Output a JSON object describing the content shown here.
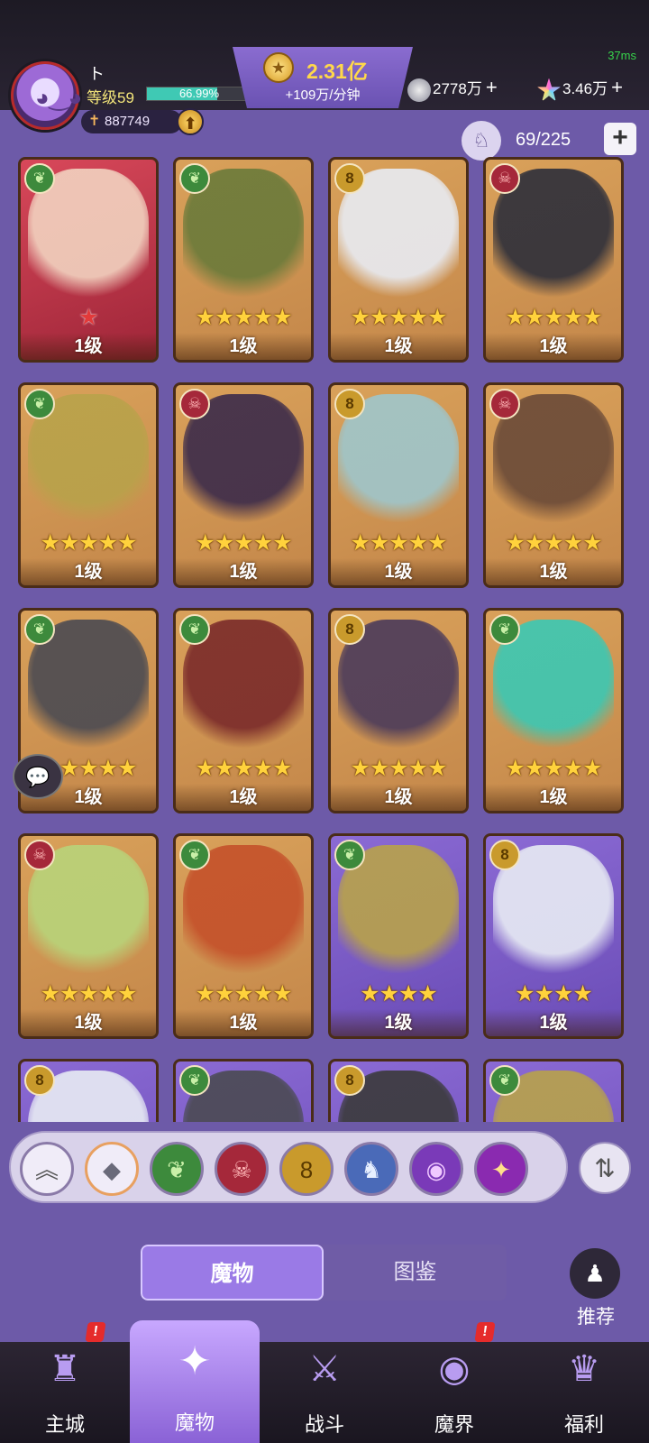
{
  "status": {
    "ping": "37ms"
  },
  "player": {
    "name": "ト",
    "level": "等级59",
    "exp_percent": "66.99%",
    "exp_fraction": 0.6699,
    "power": "887749"
  },
  "currency": {
    "gold": "2.31亿",
    "gold_rate": "+109万/分钟",
    "resource1": "2778万",
    "resource2": "3.46万"
  },
  "roster": {
    "capacity": "69/225"
  },
  "cards": [
    {
      "faction": "nature",
      "glyph": "❦",
      "stars": "★",
      "stars_count": 1,
      "level": "1级",
      "bg": "red",
      "art": "#f2d3c0"
    },
    {
      "faction": "nature",
      "glyph": "❦",
      "stars": "★★★★★",
      "stars_count": 5,
      "level": "1级",
      "bg": "gold",
      "art": "#6a7a3a"
    },
    {
      "faction": "order",
      "glyph": "8",
      "stars": "★★★★★",
      "stars_count": 5,
      "level": "1级",
      "bg": "gold",
      "art": "#e8ecf4"
    },
    {
      "faction": "demon",
      "glyph": "☠",
      "stars": "★★★★★",
      "stars_count": 5,
      "level": "1级",
      "bg": "gold",
      "art": "#2c2e3a"
    },
    {
      "faction": "nature",
      "glyph": "❦",
      "stars": "★★★★★",
      "stars_count": 5,
      "level": "1级",
      "bg": "gold",
      "art": "#b8a24a"
    },
    {
      "faction": "demon",
      "glyph": "☠",
      "stars": "★★★★★",
      "stars_count": 5,
      "level": "1级",
      "bg": "gold",
      "art": "#3a2a4a"
    },
    {
      "faction": "order",
      "glyph": "8",
      "stars": "★★★★★",
      "stars_count": 5,
      "level": "1级",
      "bg": "gold",
      "art": "#9ec6cc"
    },
    {
      "faction": "demon",
      "glyph": "☠",
      "stars": "★★★★★",
      "stars_count": 5,
      "level": "1级",
      "bg": "gold",
      "art": "#6a4a38"
    },
    {
      "faction": "nature",
      "glyph": "❦",
      "stars": "★★★★★",
      "stars_count": 5,
      "level": "1级",
      "bg": "gold",
      "art": "#4a4a52"
    },
    {
      "faction": "nature",
      "glyph": "❦",
      "stars": "★★★★★",
      "stars_count": 5,
      "level": "1级",
      "bg": "gold",
      "art": "#7a2a2a"
    },
    {
      "faction": "order",
      "glyph": "8",
      "stars": "★★★★★",
      "stars_count": 5,
      "level": "1级",
      "bg": "gold",
      "art": "#4a3a5a"
    },
    {
      "faction": "nature",
      "glyph": "❦",
      "stars": "★★★★★",
      "stars_count": 5,
      "level": "1级",
      "bg": "gold",
      "art": "#3ac8b4"
    },
    {
      "faction": "demon",
      "glyph": "☠",
      "stars": "★★★★★",
      "stars_count": 5,
      "level": "1级",
      "bg": "gold",
      "art": "#b8d47a"
    },
    {
      "faction": "nature",
      "glyph": "❦",
      "stars": "★★★★★",
      "stars_count": 5,
      "level": "1级",
      "bg": "gold",
      "art": "#c4502a"
    },
    {
      "faction": "nature",
      "glyph": "❦",
      "stars": "★★★★",
      "stars_count": 4,
      "level": "1级",
      "bg": "purple",
      "art": "#b8a24a"
    },
    {
      "faction": "order",
      "glyph": "8",
      "stars": "★★★★",
      "stars_count": 4,
      "level": "1级",
      "bg": "purple",
      "art": "#e8ecf4"
    },
    {
      "faction": "order",
      "glyph": "8",
      "stars": "",
      "stars_count": 0,
      "level": "",
      "bg": "purple",
      "art": "#e8ecf4"
    },
    {
      "faction": "nature",
      "glyph": "❦",
      "stars": "",
      "stars_count": 0,
      "level": "",
      "bg": "purple",
      "art": "#4a4a52"
    },
    {
      "faction": "order",
      "glyph": "8",
      "stars": "",
      "stars_count": 0,
      "level": "",
      "bg": "purple",
      "art": "#3a3a3a"
    },
    {
      "faction": "nature",
      "glyph": "❦",
      "stars": "",
      "stars_count": 0,
      "level": "",
      "bg": "purple",
      "art": "#b8a24a"
    }
  ],
  "filters": [
    {
      "name": "collapse",
      "glyph": "︽",
      "bg": "#f0ecf8",
      "color": "#555"
    },
    {
      "name": "all",
      "glyph": "◆",
      "bg": "#f0ecf8",
      "color": "#6a6a7a"
    },
    {
      "name": "nature",
      "glyph": "❦",
      "bg": "#3d8a3c",
      "color": "#c9f0a8"
    },
    {
      "name": "demon",
      "glyph": "☠",
      "bg": "#a5283a",
      "color": "#ffb8b8"
    },
    {
      "name": "order",
      "glyph": "8",
      "bg": "#c99a2c",
      "color": "#5a3a00"
    },
    {
      "name": "dragon",
      "glyph": "♞",
      "bg": "#4a6ab8",
      "color": "#e8f0ff"
    },
    {
      "name": "eye",
      "glyph": "◉",
      "bg": "#7a3ab8",
      "color": "#f0c8ff"
    },
    {
      "name": "void",
      "glyph": "✦",
      "bg": "#8a2ab0",
      "color": "#ffe08a"
    }
  ],
  "tabs": {
    "monsters": "魔物",
    "codex": "图鉴"
  },
  "recommend": {
    "label": "推荐"
  },
  "nav": [
    {
      "label": "主城",
      "icon": "♜",
      "badge": "!",
      "active": false
    },
    {
      "label": "魔物",
      "icon": "✦",
      "badge": "",
      "active": true
    },
    {
      "label": "战斗",
      "icon": "⚔",
      "badge": "",
      "active": false
    },
    {
      "label": "魔界",
      "icon": "◉",
      "badge": "!",
      "active": false
    },
    {
      "label": "福利",
      "icon": "♛",
      "badge": "",
      "active": false
    }
  ]
}
